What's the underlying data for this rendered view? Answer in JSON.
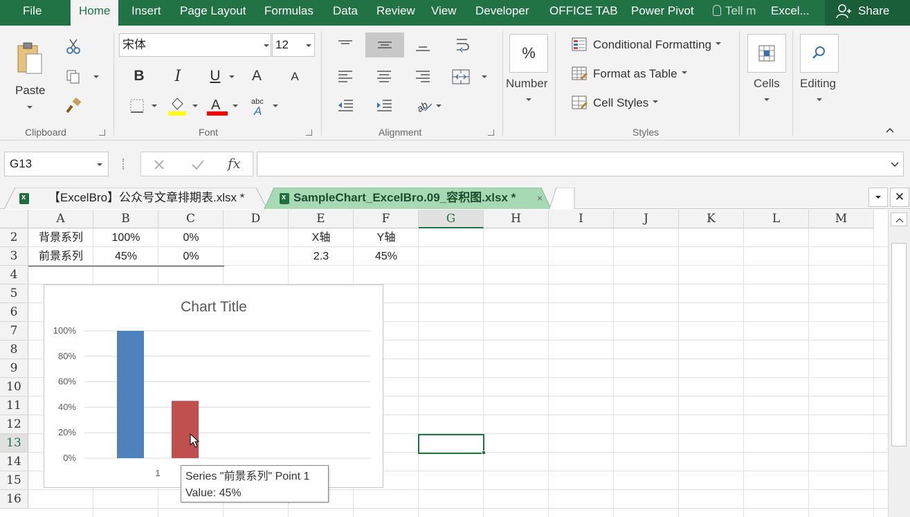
{
  "menubar": {
    "file": "File",
    "tabs": [
      "Home",
      "Insert",
      "Page Layout",
      "Formulas",
      "Data",
      "Review",
      "View",
      "Developer",
      "OFFICE TAB",
      "Power Pivot"
    ],
    "tell_me": "Tell m",
    "excel": "Excel...",
    "share": "Share",
    "accent": "#217346"
  },
  "ribbon": {
    "clipboard": {
      "paste": "Paste",
      "label": "Clipboard"
    },
    "font": {
      "name": "宋体",
      "size": "12",
      "bold": "B",
      "italic": "I",
      "underline": "U",
      "grow": "A",
      "shrink": "A",
      "label": "Font",
      "highlight_color": "#ffff00",
      "font_color": "#ff0000"
    },
    "alignment": {
      "label": "Alignment"
    },
    "number": {
      "symbol": "%",
      "label": "Number"
    },
    "styles": {
      "conditional": "Conditional Formatting",
      "table": "Format as Table",
      "cell_styles": "Cell Styles",
      "label": "Styles"
    },
    "cells": {
      "label": "Cells"
    },
    "editing": {
      "label": "Editing"
    }
  },
  "formula_bar": {
    "name_box": "G13",
    "formula": ""
  },
  "workbooks": [
    {
      "label": "【ExcelBro】公众号文章排期表.xlsx *",
      "active": false
    },
    {
      "label": "SampleChart_ExcelBro.09_容积图.xlsx *",
      "active": true
    }
  ],
  "grid": {
    "columns": [
      "A",
      "B",
      "C",
      "D",
      "E",
      "F",
      "G",
      "H",
      "I",
      "J",
      "K",
      "L",
      "M"
    ],
    "rows": [
      "2",
      "3",
      "4",
      "5",
      "6",
      "7",
      "8",
      "9",
      "10",
      "11",
      "12",
      "13",
      "14",
      "15",
      "16"
    ],
    "selected_col": "G",
    "selected_row": "13",
    "cells": {
      "A2": "背景系列",
      "B2": "100%",
      "C2": "0%",
      "E2": "X轴",
      "F2": "Y轴",
      "A3": "前景系列",
      "B3": "45%",
      "C3": "0%",
      "E3": "2.3",
      "F3": "45%"
    }
  },
  "chart_data": {
    "type": "bar",
    "title": "Chart Title",
    "categories": [
      "1"
    ],
    "series": [
      {
        "values": [
          1.0
        ],
        "color": "#4f81bd"
      },
      {
        "values": [
          0.45
        ],
        "color": "#c0504d"
      }
    ],
    "yticks": [
      "0%",
      "20%",
      "40%",
      "60%",
      "80%",
      "100%"
    ],
    "ylim": [
      0,
      1
    ],
    "grid": true
  },
  "tooltip": {
    "line1": "Series \"前景系列\" Point 1",
    "line2": "Value: 45%"
  }
}
